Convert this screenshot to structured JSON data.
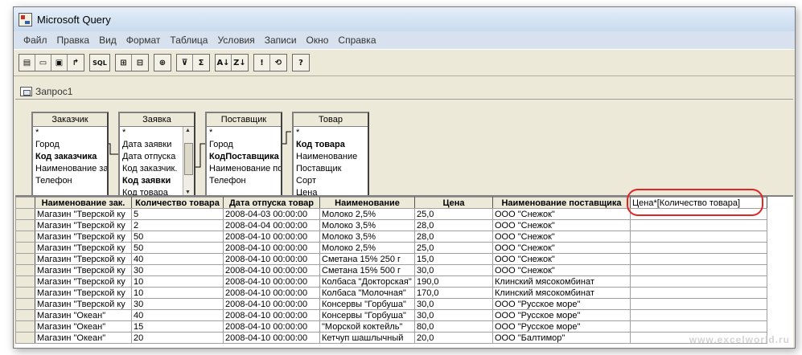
{
  "window": {
    "title": "Microsoft Query"
  },
  "menu": [
    "Файл",
    "Правка",
    "Вид",
    "Формат",
    "Таблица",
    "Условия",
    "Записи",
    "Окно",
    "Справка"
  ],
  "toolbar": {
    "sql_label": "SQL",
    "sigma_label": "Σ",
    "az_label": "A↓",
    "za_label": "Z↓",
    "exclaim_label": "!",
    "help_label": "?"
  },
  "query_window": {
    "title": "Запрос1"
  },
  "tables": [
    {
      "name": "Заказчик",
      "fields": [
        {
          "label": "*",
          "bold": false
        },
        {
          "label": "Город",
          "bold": false
        },
        {
          "label": "Код заказчика",
          "bold": true
        },
        {
          "label": "Наименование за",
          "bold": false
        },
        {
          "label": "Телефон",
          "bold": false
        }
      ]
    },
    {
      "name": "Заявка",
      "fields": [
        {
          "label": "*",
          "bold": false
        },
        {
          "label": "Дата заявки",
          "bold": false
        },
        {
          "label": "Дата отпуска",
          "bold": false
        },
        {
          "label": "Код заказчик.",
          "bold": false
        },
        {
          "label": "Код заявки",
          "bold": true
        },
        {
          "label": "Код товара",
          "bold": false
        }
      ]
    },
    {
      "name": "Поставщик",
      "fields": [
        {
          "label": "*",
          "bold": false
        },
        {
          "label": "Город",
          "bold": false
        },
        {
          "label": "КодПоставщика",
          "bold": true
        },
        {
          "label": "Наименование по",
          "bold": false
        },
        {
          "label": "Телефон",
          "bold": false
        }
      ]
    },
    {
      "name": "Товар",
      "fields": [
        {
          "label": "*",
          "bold": false
        },
        {
          "label": "Код товара",
          "bold": true
        },
        {
          "label": "Наименование",
          "bold": false
        },
        {
          "label": "Поставщик",
          "bold": false
        },
        {
          "label": "Сорт",
          "bold": false
        },
        {
          "label": "Цена",
          "bold": false
        }
      ]
    }
  ],
  "grid": {
    "columns": [
      "Наименование зак.",
      "Количество товара",
      "Дата отпуска товар",
      "Наименование",
      "Цена",
      "Наименование поставщика",
      "Цена*[Количество товара]"
    ],
    "rows": [
      [
        "Магазин \"Тверской ку",
        "5",
        "2008-04-03 00:00:00",
        "Молоко 2,5%",
        "25,0",
        "ООО \"Снежок\"",
        ""
      ],
      [
        "Магазин \"Тверской ку",
        "2",
        "2008-04-04 00:00:00",
        "Молоко 3,5%",
        "28,0",
        "ООО \"Снежок\"",
        ""
      ],
      [
        "Магазин \"Тверской ку",
        "50",
        "2008-04-10 00:00:00",
        "Молоко 3,5%",
        "28,0",
        "ООО \"Снежок\"",
        ""
      ],
      [
        "Магазин \"Тверской ку",
        "50",
        "2008-04-10 00:00:00",
        "Молоко 2,5%",
        "25,0",
        "ООО \"Снежок\"",
        ""
      ],
      [
        "Магазин \"Тверской ку",
        "40",
        "2008-04-10 00:00:00",
        "Сметана 15% 250 г",
        "15,0",
        "ООО \"Снежок\"",
        ""
      ],
      [
        "Магазин \"Тверской ку",
        "30",
        "2008-04-10 00:00:00",
        "Сметана 15% 500 г",
        "30,0",
        "ООО \"Снежок\"",
        ""
      ],
      [
        "Магазин \"Тверской ку",
        "10",
        "2008-04-10 00:00:00",
        "Колбаса \"Докторская\"",
        "190,0",
        "Клинский мясокомбинат",
        ""
      ],
      [
        "Магазин \"Тверской ку",
        "10",
        "2008-04-10 00:00:00",
        "Колбаса \"Молочная\"",
        "170,0",
        "Клинский мясокомбинат",
        ""
      ],
      [
        "Магазин \"Тверской ку",
        "30",
        "2008-04-10 00:00:00",
        "Консервы \"Горбуша\"",
        "30,0",
        "ООО \"Русское море\"",
        ""
      ],
      [
        "Магазин \"Океан\"",
        "40",
        "2008-04-10 00:00:00",
        "Консервы \"Горбуша\"",
        "30,0",
        "ООО \"Русское море\"",
        ""
      ],
      [
        "Магазин \"Океан\"",
        "15",
        "2008-04-10 00:00:00",
        "\"Морской коктейль\"",
        "80,0",
        "ООО \"Русское море\"",
        ""
      ],
      [
        "Магазин \"Океан\"",
        "20",
        "2008-04-10 00:00:00",
        "Кетчуп шашлычный",
        "20,0",
        "ООО \"Балтимор\"",
        ""
      ]
    ]
  },
  "watermark": "www.excelworld.ru"
}
